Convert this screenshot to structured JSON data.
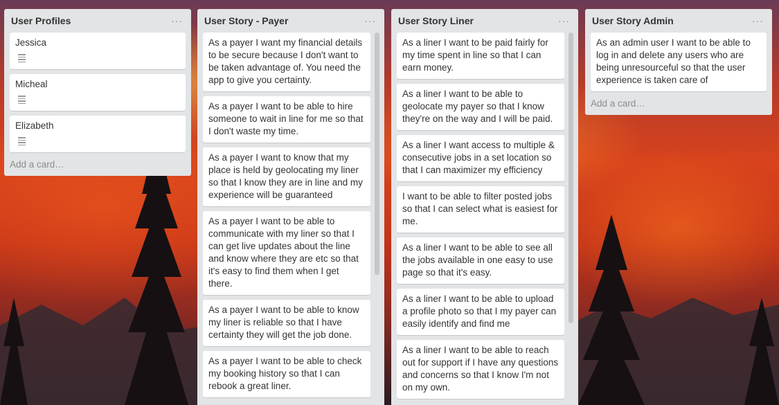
{
  "lists": [
    {
      "title": "User Profiles",
      "cards": [
        "Jessica",
        "Micheal",
        "Elizabeth"
      ],
      "add_card": "Add a card…"
    },
    {
      "title": "User Story - Payer",
      "cards": [
        "As a payer I want my financial details to be secure because I don't want to be taken advantage of. You need the app to give you certainty.",
        "As a payer I want to be able to hire someone to wait in line for me so that I don't waste my time.",
        "As a payer I want to know that my place is held by geolocating my liner so that I know they are in line and my experience will be guaranteed",
        "As a payer I want to be able to communicate with my liner so that I can get live updates about the line and know where they are etc so that it's easy to find them when I get there.",
        "As a payer I want to be able to know my liner is reliable so that I have certainty they will get the job done.",
        "As a payer I want to be able to check my booking history so that I can rebook a great liner."
      ]
    },
    {
      "title": "User Story Liner",
      "cards": [
        "As a liner I want to be paid fairly for my time spent in line so that I can earn money.",
        "As a liner I want to be able to geolocate my payer so that I know they're on the way and I will be paid.",
        "As a liner I want access to multiple & consecutive jobs in a set location so that I can maximizer my efficiency",
        "I want to be able to filter posted jobs so that I can select what is easiest for me.",
        "As a liner I want to be able to see all the jobs available in one easy to use page so that it's easy.",
        "As a liner I want to be able to upload a profile photo so that I my payer can easily identify and find me",
        "As a liner I want to be able to reach out for support if I have any questions and concerns so that I know I'm not on my own."
      ]
    },
    {
      "title": "User Story Admin",
      "cards": [
        "As an admin user I want to be able to log in and delete any users who are being unresourceful so that the user experience is taken care of"
      ],
      "add_card": "Add a card…"
    }
  ],
  "menu_glyph": "···",
  "icons": {
    "card_badge": "description-icon",
    "list_menu": "ellipsis-icon"
  },
  "colors": {
    "list_bg": "#e2e4e6",
    "card_bg": "#ffffff",
    "sunset_red": "#d8431c"
  }
}
